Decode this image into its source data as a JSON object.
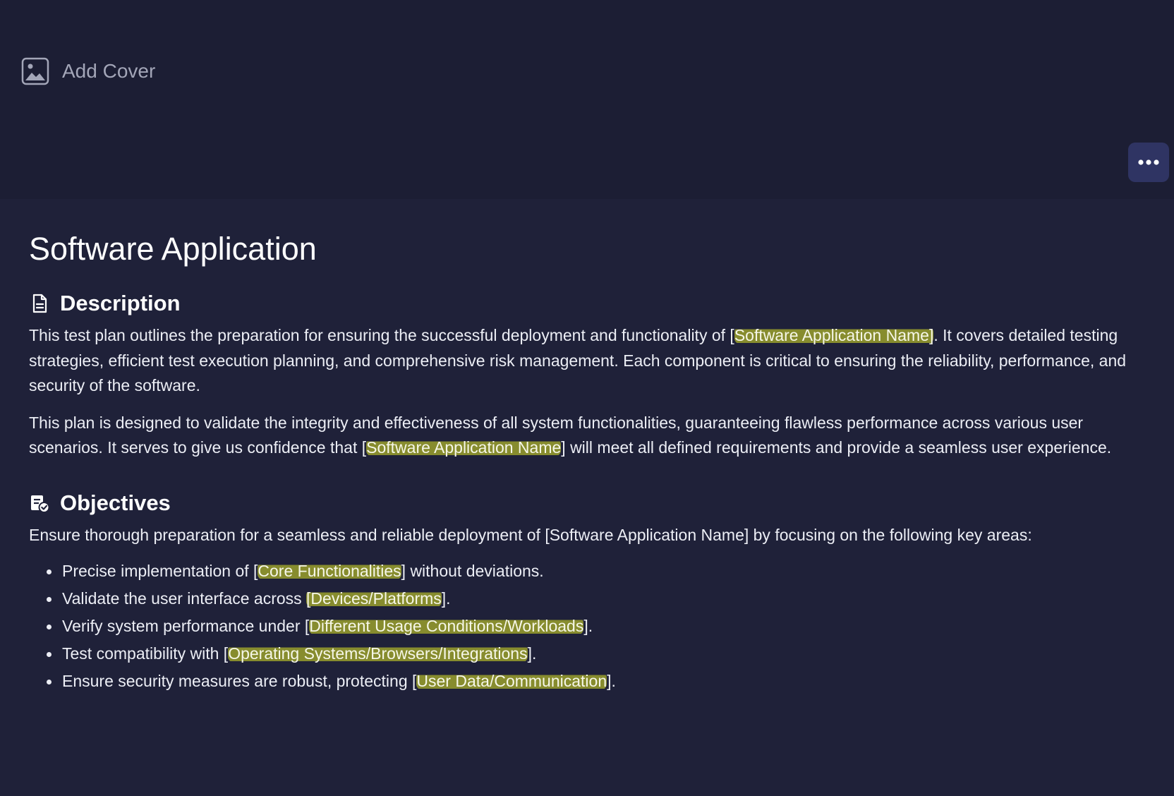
{
  "cover": {
    "add_cover_label": "Add Cover",
    "icon": "image-icon"
  },
  "toolbar": {
    "more_icon": "more-horizontal-icon"
  },
  "document": {
    "title": "Software Application",
    "description": {
      "heading": "Description",
      "icon": "document-icon",
      "p1": {
        "before": "This test plan outlines the preparation for ensuring the successful deployment and functionality of [",
        "highlight": "Software Application Name]",
        "after": ". It covers detailed testing strategies, efficient test execution planning, and comprehensive risk management. Each component is critical to ensuring the reliability, performance, and security of the software."
      },
      "p2": {
        "before": "This plan is designed to validate the integrity and effectiveness of all system functionalities, guaranteeing flawless performance across various user scenarios. It serves to give us confidence that [",
        "highlight": "Software Application Name",
        "after": "] will meet all defined requirements and provide a seamless user experience."
      }
    },
    "objectives": {
      "heading": "Objectives",
      "icon": "checklist-icon",
      "intro": "Ensure thorough preparation for a seamless and reliable deployment of [Software Application Name] by focusing on the following key areas:",
      "items": [
        {
          "before": "Precise implementation of [",
          "highlight": "Core Functionalities",
          "after": "] without deviations."
        },
        {
          "before": "Validate the user interface across ",
          "highlight": "[Devices/Platforms",
          "after": "]."
        },
        {
          "before": "Verify system performance under [",
          "highlight": "Different Usage Conditions/Workloads",
          "after": "]."
        },
        {
          "before": "Test compatibility with [",
          "highlight": "Operating Systems/Browsers/Integrations",
          "after": "]."
        },
        {
          "before": "Ensure security measures are robust, protecting [",
          "highlight": "User Data/Communication",
          "after": "]."
        }
      ]
    }
  },
  "colors": {
    "background": "#1f2139",
    "cover_background": "#1c1e34",
    "highlight": "#c7cd28",
    "more_button": "#2f3463"
  }
}
